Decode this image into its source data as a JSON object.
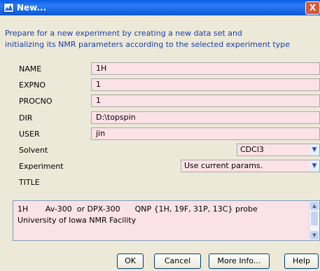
{
  "window": {
    "title": "New...",
    "close_glyph": "X"
  },
  "description": {
    "line1": "Prepare for a new experiment by creating a new data set and",
    "line2": "initializing its NMR parameters according to the selected experiment type"
  },
  "fields": [
    {
      "label": "NAME",
      "value": "1H"
    },
    {
      "label": "EXPNO",
      "value": "1"
    },
    {
      "label": "PROCNO",
      "value": "1"
    },
    {
      "label": "DIR",
      "value": "D:\\topspin"
    },
    {
      "label": "USER",
      "value": "jin"
    }
  ],
  "solvent": {
    "label": "Solvent",
    "value": "CDCl3"
  },
  "experiment": {
    "label": "Experiment",
    "value": "Use current params."
  },
  "title_section": {
    "label": "TITLE",
    "line1": "1H       Av-300  or DPX-300      QNP {1H, 19F, 31P, 13C} probe",
    "line2": "University of Iowa NMR Facility"
  },
  "buttons": {
    "ok": "OK",
    "cancel": "Cancel",
    "more_info": "More Info...",
    "help": "Help"
  },
  "colors": {
    "field_bg": "#fbe2e7",
    "description": "#1a3fa8",
    "title_bar": "#0a5ee8"
  },
  "icons": {
    "app": "app-icon",
    "close": "close-icon",
    "dropdown": "chevron-down-icon"
  }
}
